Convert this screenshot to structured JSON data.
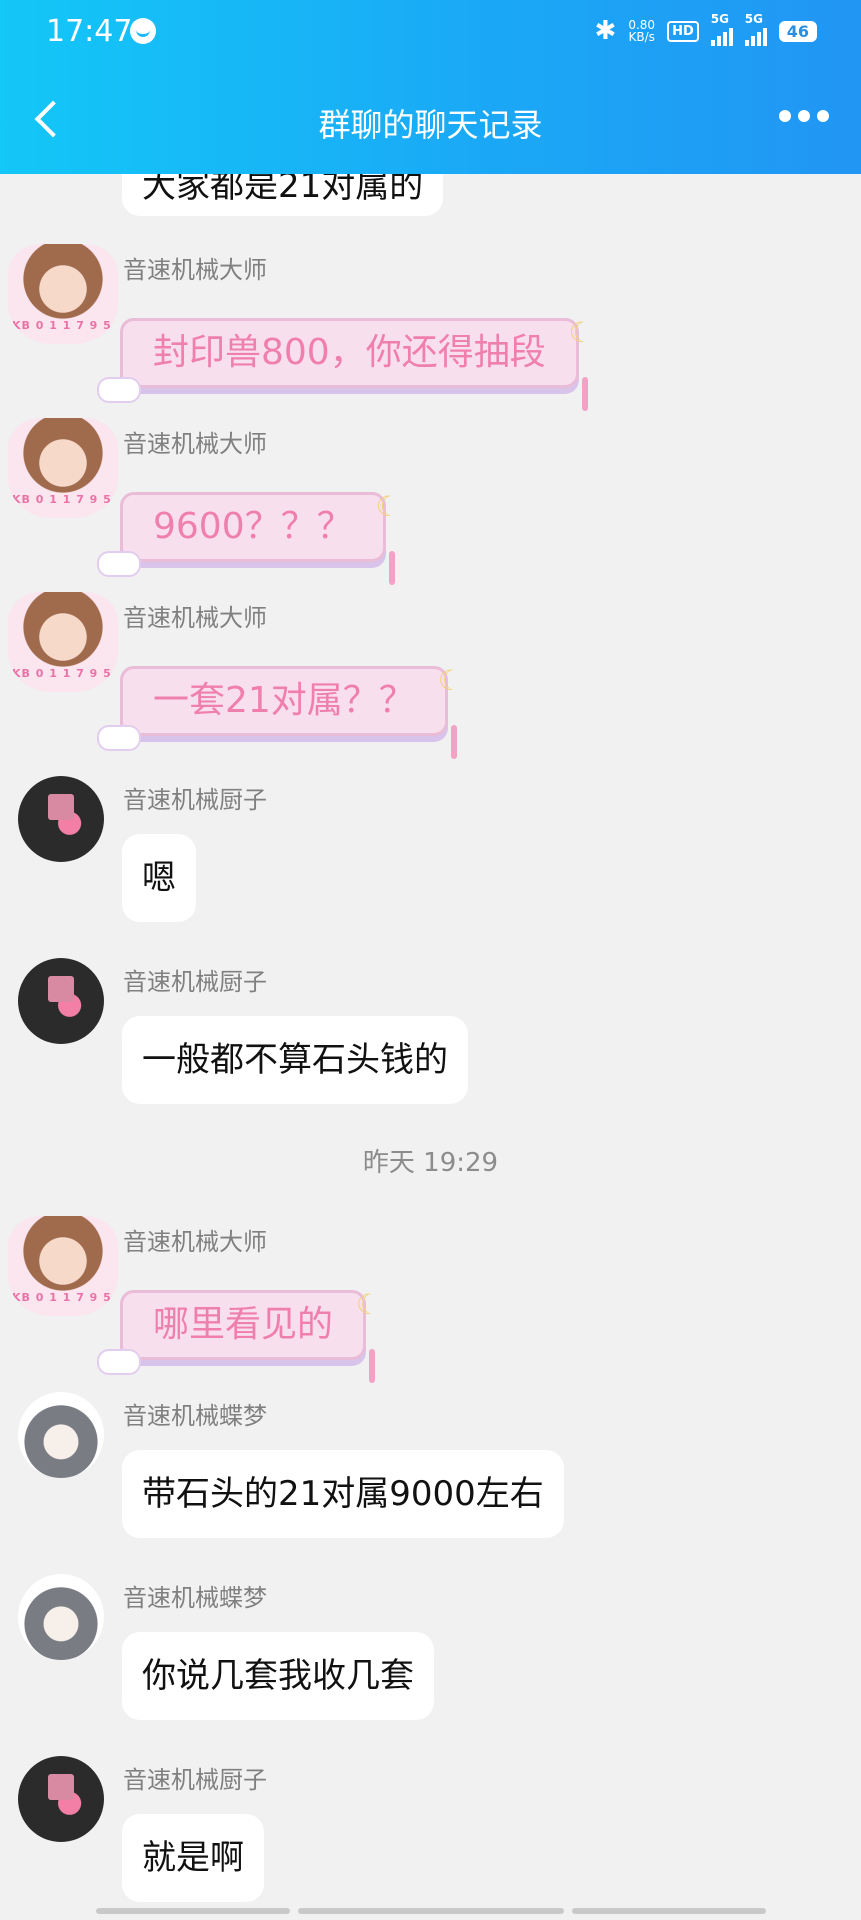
{
  "status_bar": {
    "time": "17:47",
    "net_speed_value": "0.80",
    "net_speed_unit": "KB/s",
    "hd": "HD",
    "sim1": "5G",
    "sim2": "5G",
    "battery": "46"
  },
  "header": {
    "title": "群聊的聊天记录"
  },
  "partial_message": {
    "text": "大家都是21对属的"
  },
  "messages": [
    {
      "sender": "音速机械大师",
      "text": "封印兽800，你还得抽段",
      "style": "fancy",
      "avatar": "anime-girl-avatar"
    },
    {
      "sender": "音速机械大师",
      "text": "9600？？？",
      "style": "fancy",
      "avatar": "anime-girl-avatar"
    },
    {
      "sender": "音速机械大师",
      "text": "一套21对属？？",
      "style": "fancy",
      "avatar": "anime-girl-avatar"
    },
    {
      "sender": "音速机械厨子",
      "text": "嗯",
      "style": "plain",
      "avatar": "pink-figure-avatar"
    },
    {
      "sender": "音速机械厨子",
      "text": "一般都不算石头钱的",
      "style": "plain",
      "avatar": "pink-figure-avatar"
    },
    {
      "sender": "音速机械大师",
      "text": "哪里看见的",
      "style": "fancy",
      "avatar": "anime-girl-avatar"
    },
    {
      "sender": "音速机械蝶梦",
      "text": "带石头的21对属9000左右",
      "style": "plain",
      "avatar": "silver-hair-avatar"
    },
    {
      "sender": "音速机械蝶梦",
      "text": "你说几套我收几套",
      "style": "plain",
      "avatar": "silver-hair-avatar"
    },
    {
      "sender": "音速机械厨子",
      "text": "就是啊",
      "style": "plain",
      "avatar": "pink-figure-avatar"
    }
  ],
  "timestamp": "昨天 19:29",
  "icons": [
    "bluetooth-icon",
    "back-arrow-icon",
    "more-icon"
  ]
}
